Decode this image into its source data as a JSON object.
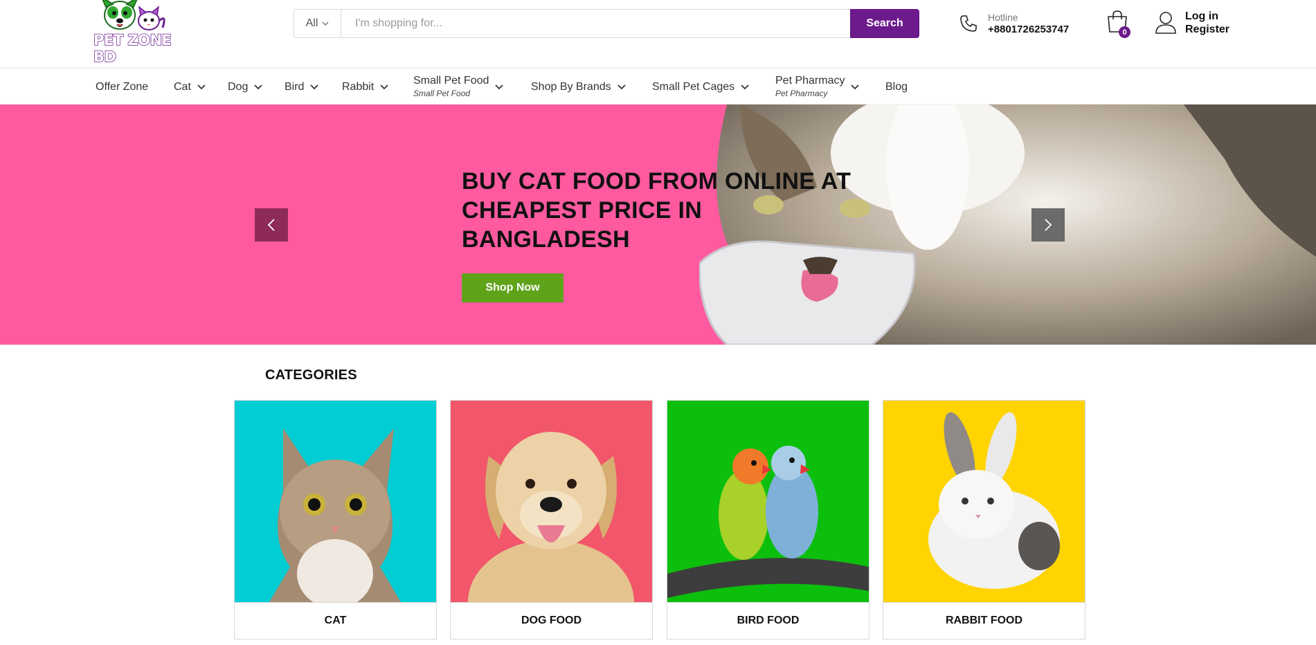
{
  "brand": {
    "logo_text": "PET ZONE BD",
    "primary_color": "#6c1a8c",
    "accent_green": "#5fa31b",
    "hero_bg": "#ff5aa0"
  },
  "search": {
    "category": "All",
    "placeholder": "I'm shopping for...",
    "button_label": "Search"
  },
  "hotline": {
    "label": "Hotline",
    "number": "+8801726253747",
    "icon": "phone-icon"
  },
  "cart": {
    "count": "0",
    "icon": "shopping-bag-icon"
  },
  "account": {
    "login": "Log in",
    "register": "Register",
    "icon": "user-icon"
  },
  "nav": {
    "items": [
      {
        "label": "Offer Zone"
      },
      {
        "label": "Cat"
      },
      {
        "label": "Dog"
      },
      {
        "label": "Bird"
      },
      {
        "label": "Rabbit"
      },
      {
        "label": "Small Pet Food",
        "sub": "Small Pet Food"
      },
      {
        "label": "Shop By Brands"
      },
      {
        "label": "Small Pet Cages"
      },
      {
        "label": "Pet Pharmacy",
        "sub": "Pet Pharmacy"
      },
      {
        "label": "Blog"
      }
    ]
  },
  "hero": {
    "title": "BUY CAT FOOD FROM ONLINE AT CHEAPEST PRICE IN BANGLADESH",
    "button_label": "Shop Now"
  },
  "categories": {
    "heading": "CATEGORIES",
    "items": [
      {
        "label": "CAT",
        "bg": "#00cdd4"
      },
      {
        "label": "DOG FOOD",
        "bg": "#f2566a"
      },
      {
        "label": "BIRD FOOD",
        "bg": "#0dbf0d"
      },
      {
        "label": "RABBIT FOOD",
        "bg": "#ffd400"
      }
    ]
  }
}
